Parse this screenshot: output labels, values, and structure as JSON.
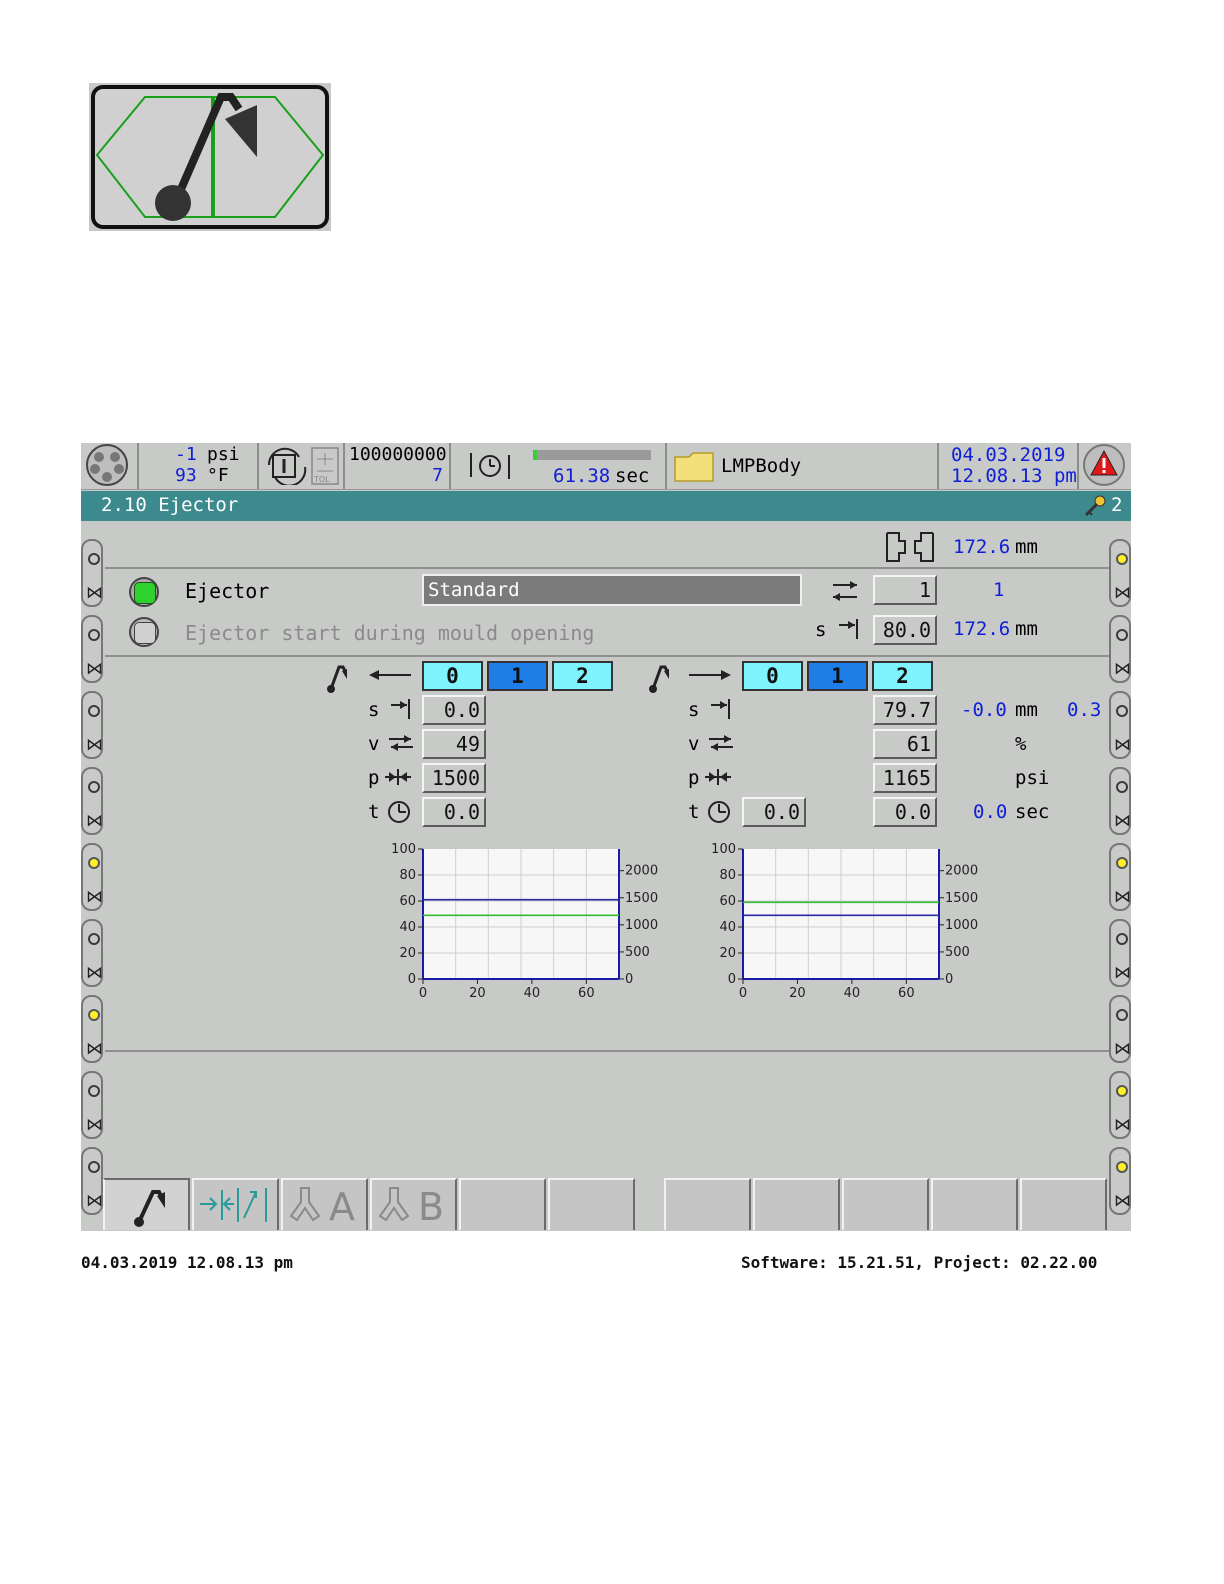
{
  "header": {
    "pressure_value": "-1",
    "pressure_unit": "psi",
    "temp_value": "93",
    "temp_unit": "°F",
    "counter_top": "100000000",
    "counter_bottom": "7",
    "cycle_time": "61.38",
    "cycle_unit": "sec",
    "cycle_progress": 0.03,
    "mould_name": "LMPBody",
    "date": "04.03.2019",
    "time": "12.08.13 pm",
    "tolerance_label": "TOL"
  },
  "title": {
    "text": "2.10 Ejector",
    "access_level": "2"
  },
  "mould_stroke": {
    "value": "172.6",
    "unit": "mm"
  },
  "ejector_row": {
    "label": "Ejector",
    "mode": "Standard",
    "count_input": "1",
    "count_actual": "1"
  },
  "start_row": {
    "label": "Ejector start during mould opening",
    "s_label": "s",
    "s_value": "80.0",
    "actual": "172.6",
    "unit": "mm"
  },
  "backward": {
    "stages": [
      "0",
      "1",
      "2"
    ],
    "active_stage": 1,
    "s": "0.0",
    "v": "49",
    "p": "1500",
    "t": "0.0"
  },
  "forward": {
    "stages": [
      "0",
      "1",
      "2"
    ],
    "active_stage": 1,
    "s": "79.7",
    "v": "61",
    "p": "1165",
    "t_delay": "0.0",
    "t": "0.0"
  },
  "param_labels": {
    "s": "s",
    "v": "v",
    "p": "p",
    "t": "t"
  },
  "actuals": {
    "s_actual": "-0.0",
    "s_unit": "mm",
    "s_extra": "0.3",
    "v_unit": "%",
    "p_unit": "psi",
    "t_actual": "0.0",
    "t_unit": "sec"
  },
  "chart_data": [
    {
      "type": "line",
      "x_ticks": [
        "0",
        "20",
        "40",
        "60"
      ],
      "y_left_ticks": [
        "0",
        "20",
        "40",
        "60",
        "80",
        "100"
      ],
      "y_right_ticks": [
        "0",
        "500",
        "1000",
        "1500",
        "2000"
      ],
      "xlim": [
        0,
        72
      ],
      "ylim": [
        0,
        100
      ],
      "series": [
        {
          "color": "#2a2aa8",
          "values": [
            61,
            61
          ]
        },
        {
          "color": "#33bb33",
          "values": [
            49,
            49
          ]
        }
      ]
    },
    {
      "type": "line",
      "x_ticks": [
        "0",
        "20",
        "40",
        "60"
      ],
      "y_left_ticks": [
        "0",
        "20",
        "40",
        "60",
        "80",
        "100"
      ],
      "y_right_ticks": [
        "0",
        "500",
        "1000",
        "1500",
        "2000"
      ],
      "xlim": [
        0,
        72
      ],
      "ylim": [
        0,
        100
      ],
      "series": [
        {
          "color": "#33bb33",
          "values": [
            59,
            59
          ]
        },
        {
          "color": "#2a2aa8",
          "values": [
            49,
            49
          ]
        }
      ]
    }
  ],
  "tabs": [
    "ejector-tab",
    "core-pull-tab",
    "A",
    "B",
    "",
    "",
    "",
    "",
    "",
    "",
    ""
  ],
  "footer": {
    "left": "04.03.2019 12.08.13 pm",
    "right": "Software: 15.21.51, Project: 02.22.00"
  },
  "colors": {
    "title_bar": "#3d8a8e",
    "stage_light": "#7ff4ff",
    "stage_active": "#1e7de6",
    "value_blue": "#1020d8"
  }
}
